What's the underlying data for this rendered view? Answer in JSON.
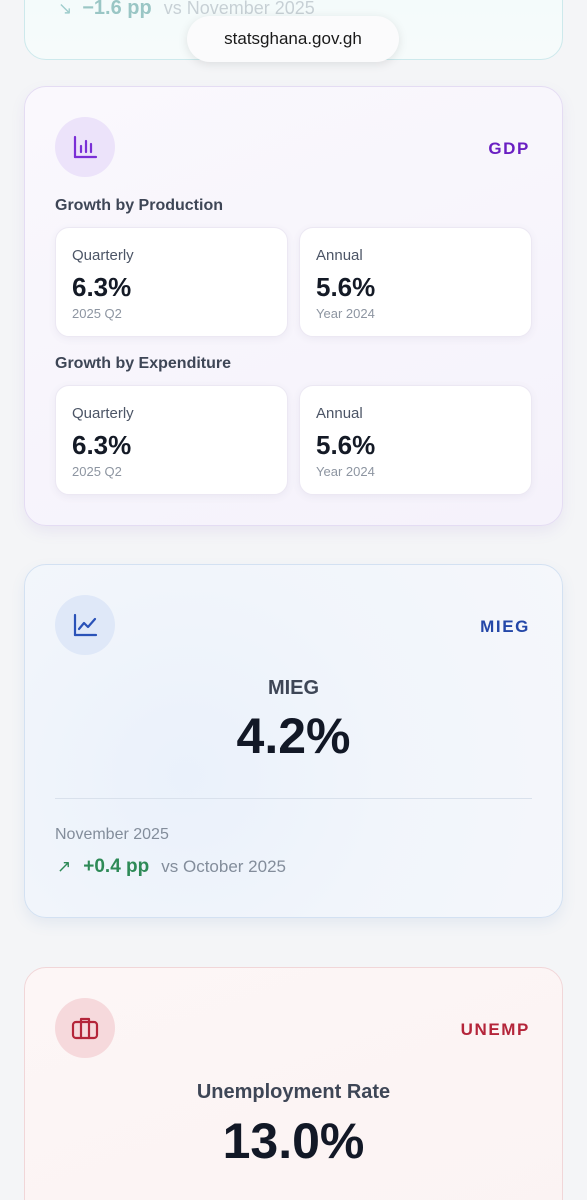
{
  "browser": {
    "url": "statsghana.gov.gh"
  },
  "top_card": {
    "change_arrow": "↘",
    "change_value": "−1.6 pp",
    "change_vs": "vs November 2025"
  },
  "gdp": {
    "tag": "GDP",
    "icon": "bar-chart-icon",
    "production": {
      "title": "Growth by Production",
      "quarterly": {
        "label": "Quarterly",
        "value": "6.3%",
        "sub": "2025 Q2"
      },
      "annual": {
        "label": "Annual",
        "value": "5.6%",
        "sub": "Year 2024"
      }
    },
    "expenditure": {
      "title": "Growth by Expenditure",
      "quarterly": {
        "label": "Quarterly",
        "value": "6.3%",
        "sub": "2025 Q2"
      },
      "annual": {
        "label": "Annual",
        "value": "5.6%",
        "sub": "Year 2024"
      }
    }
  },
  "mieg": {
    "tag": "MIEG",
    "icon": "line-chart-icon",
    "label": "MIEG",
    "value": "4.2%",
    "period": "November 2025",
    "change_arrow": "↗",
    "change_value": "+0.4 pp",
    "change_vs": "vs October 2025"
  },
  "unemp": {
    "tag": "UNEMP",
    "icon": "briefcase-icon",
    "label": "Unemployment Rate",
    "value": "13.0%"
  },
  "colors": {
    "gdp_accent": "#6a1fc2",
    "mieg_accent": "#2447a8",
    "unemp_accent": "#b4253a",
    "positive": "#2e8a57",
    "teal": "#1f7f7c"
  }
}
